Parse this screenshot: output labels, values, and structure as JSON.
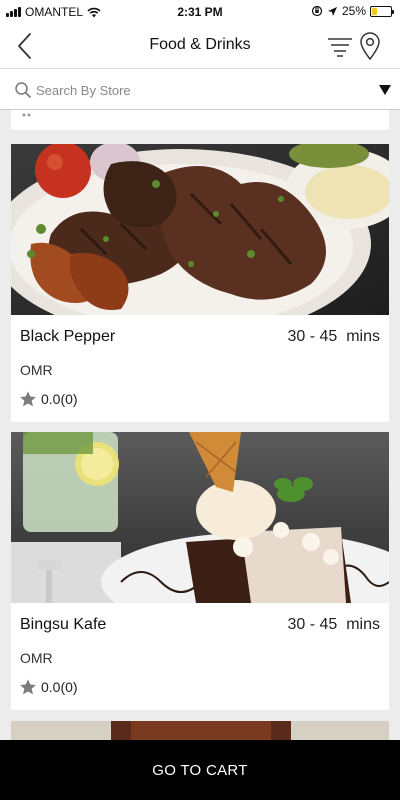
{
  "status_bar": {
    "carrier": "OMANTEL",
    "time": "2:31 PM",
    "battery_percent": "25%",
    "battery_level": 0.25
  },
  "header": {
    "title": "Food & Drinks",
    "back_icon": "chevron-left-icon",
    "filter_icon": "filter-icon",
    "location_icon": "location-pin-icon"
  },
  "search": {
    "placeholder": "Search By Store",
    "icon": "search-icon",
    "dropdown_icon": "triangle-down-icon"
  },
  "stores": [
    {
      "name": "Black Pepper",
      "delivery_time": "30 - 45  mins",
      "currency": "OMR",
      "rating": "0.0(0)"
    },
    {
      "name": "Bingsu Kafe",
      "delivery_time": "30 - 45  mins",
      "currency": "OMR",
      "rating": "0.0(0)"
    }
  ],
  "footer": {
    "cart_label": "GO TO CART"
  },
  "colors": {
    "background": "#ececec",
    "card": "#ffffff",
    "footer": "#000000",
    "battery": "#f5c518"
  }
}
